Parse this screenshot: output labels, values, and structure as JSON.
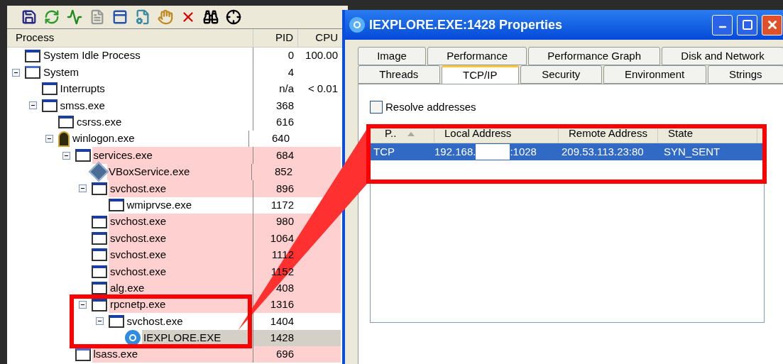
{
  "process_list": {
    "columns": [
      "Process",
      "PID",
      "CPU"
    ],
    "tree": [
      {
        "name": "System Idle Process",
        "pid": "0",
        "cpu": "100.00",
        "kind": "window",
        "highlighted": false,
        "selected": false
      },
      {
        "name": "System",
        "pid": "4",
        "kind": "blank",
        "highlighted": false,
        "selected": false,
        "expanded": true,
        "children": [
          {
            "name": "Interrupts",
            "pid": "n/a",
            "cpu": "< 0.01",
            "kind": "window",
            "highlighted": false,
            "selected": false
          },
          {
            "name": "smss.exe",
            "pid": "368",
            "kind": "window",
            "highlighted": false,
            "selected": false,
            "expanded": true,
            "children": [
              {
                "name": "csrss.exe",
                "pid": "616",
                "kind": "window",
                "highlighted": false,
                "selected": false
              },
              {
                "name": "winlogon.exe",
                "pid": "640",
                "kind": "door",
                "highlighted": false,
                "selected": false,
                "expanded": true,
                "children": [
                  {
                    "name": "services.exe",
                    "pid": "684",
                    "kind": "window",
                    "highlighted": true,
                    "selected": false,
                    "expanded": true,
                    "children": [
                      {
                        "name": "VBoxService.exe",
                        "pid": "852",
                        "kind": "cube",
                        "highlighted": true,
                        "selected": false
                      },
                      {
                        "name": "svchost.exe",
                        "pid": "896",
                        "kind": "window",
                        "highlighted": true,
                        "selected": false,
                        "expanded": true,
                        "children": [
                          {
                            "name": "wmiprvse.exe",
                            "pid": "1172",
                            "kind": "window",
                            "highlighted": false,
                            "selected": false
                          }
                        ]
                      },
                      {
                        "name": "svchost.exe",
                        "pid": "980",
                        "kind": "window",
                        "highlighted": true,
                        "selected": false
                      },
                      {
                        "name": "svchost.exe",
                        "pid": "1064",
                        "kind": "window",
                        "highlighted": true,
                        "selected": false
                      },
                      {
                        "name": "svchost.exe",
                        "pid": "1112",
                        "kind": "window",
                        "highlighted": true,
                        "selected": false
                      },
                      {
                        "name": "svchost.exe",
                        "pid": "1152",
                        "kind": "window",
                        "highlighted": true,
                        "selected": false
                      },
                      {
                        "name": "alg.exe",
                        "pid": "408",
                        "kind": "window",
                        "highlighted": true,
                        "selected": false
                      },
                      {
                        "name": "rpcnetp.exe",
                        "pid": "1316",
                        "kind": "window",
                        "highlighted": true,
                        "selected": false,
                        "expanded": true,
                        "children": [
                          {
                            "name": "svchost.exe",
                            "pid": "1404",
                            "kind": "window",
                            "highlighted": false,
                            "selected": false,
                            "expanded": true,
                            "children": [
                              {
                                "name": "IEXPLORE.EXE",
                                "pid": "1428",
                                "kind": "browser",
                                "highlighted": false,
                                "selected": true
                              }
                            ]
                          }
                        ]
                      }
                    ]
                  },
                  {
                    "name": "lsass.exe",
                    "pid": "696",
                    "kind": "blank",
                    "highlighted": true,
                    "selected": false
                  }
                ]
              }
            ]
          }
        ]
      }
    ]
  },
  "properties_window": {
    "title": "IEXPLORE.EXE:1428 Properties",
    "tab_rows": [
      [
        {
          "label": "Image",
          "selected": false
        },
        {
          "label": "Performance",
          "selected": false
        },
        {
          "label": "Performance Graph",
          "selected": false
        },
        {
          "label": "Disk and Network",
          "selected": false
        }
      ],
      [
        {
          "label": "Threads",
          "selected": false
        },
        {
          "label": "TCP/IP",
          "selected": true
        },
        {
          "label": "Security",
          "selected": false
        },
        {
          "label": "Environment",
          "selected": false
        },
        {
          "label": "Strings",
          "selected": false
        }
      ]
    ],
    "resolve_addresses": {
      "label": "Resolve addresses",
      "checked": false
    },
    "connections": {
      "columns": [
        "P..",
        "Local Address",
        "Remote Address",
        "State"
      ],
      "rows": [
        {
          "protocol": "TCP",
          "local_address_start": "192.168.",
          "local_address_end": ":1028",
          "remote_address": "209.53.113.23:80",
          "state": "SYN_SENT",
          "selected": true
        }
      ]
    }
  }
}
